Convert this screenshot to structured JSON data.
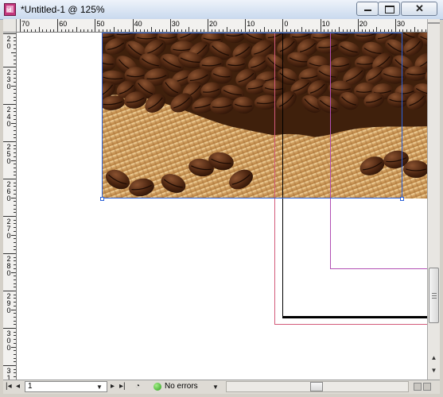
{
  "window": {
    "title": "*Untitled-1 @ 125%",
    "app_icon_text": "Id",
    "buttons": {
      "minimize": "minimize",
      "maximize": "maximize",
      "close": "✕"
    }
  },
  "rulers": {
    "horizontal_labels": [
      "70",
      "60",
      "50",
      "40",
      "30",
      "20",
      "10",
      "0",
      "10",
      "20",
      "30"
    ],
    "vertical_labels": [
      "20",
      "230",
      "240",
      "250",
      "260",
      "270",
      "280",
      "290",
      "300",
      "31"
    ]
  },
  "canvas": {
    "image": "coffee beans on burlap",
    "colors": {
      "guide_pink": "#d35a7a",
      "guide_purple": "#b14fb3",
      "selection_blue": "#2c62d8",
      "margin_black": "#000000"
    }
  },
  "statusbar": {
    "page_number": "1",
    "preflight_status": "No errors",
    "status_color": "#2a9d1b"
  }
}
